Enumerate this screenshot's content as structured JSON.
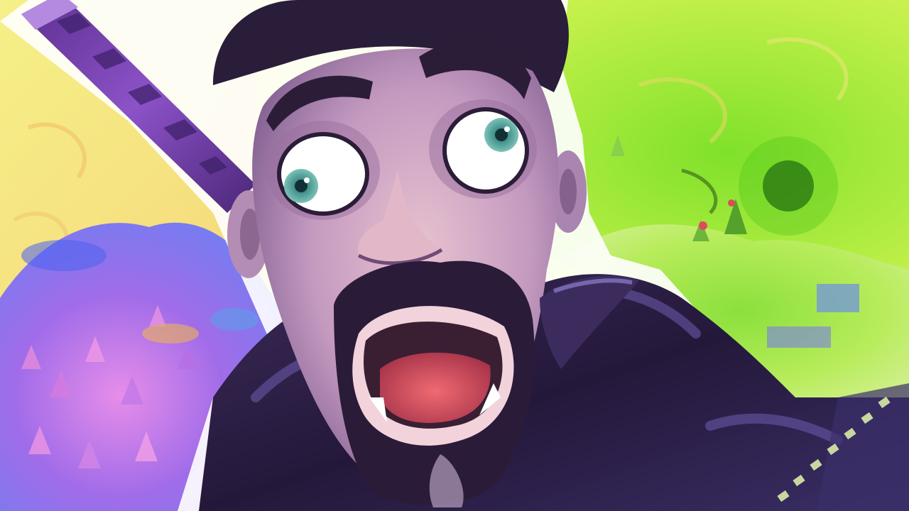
{
  "scene": {
    "subject": "shocked-character-face",
    "palette": {
      "sky_yellow": "#f7ee74",
      "sky_lime": "#b6ef3c",
      "terrain_purple": "#9b5fe8",
      "terrain_pink": "#e88ae8",
      "terrain_blue": "#5a78f0",
      "skin": "#caa3c6",
      "skin_shadow": "#8d6a98",
      "beard": "#2e1f3b",
      "eye_iris": "#4f9b94",
      "jacket": "#2a1d3d",
      "jacket_highlight": "#6f5cb0",
      "mouth_inner": "#e35a66",
      "sword_handle": "#7d45b8",
      "zipper": "#c8d6a0"
    }
  }
}
